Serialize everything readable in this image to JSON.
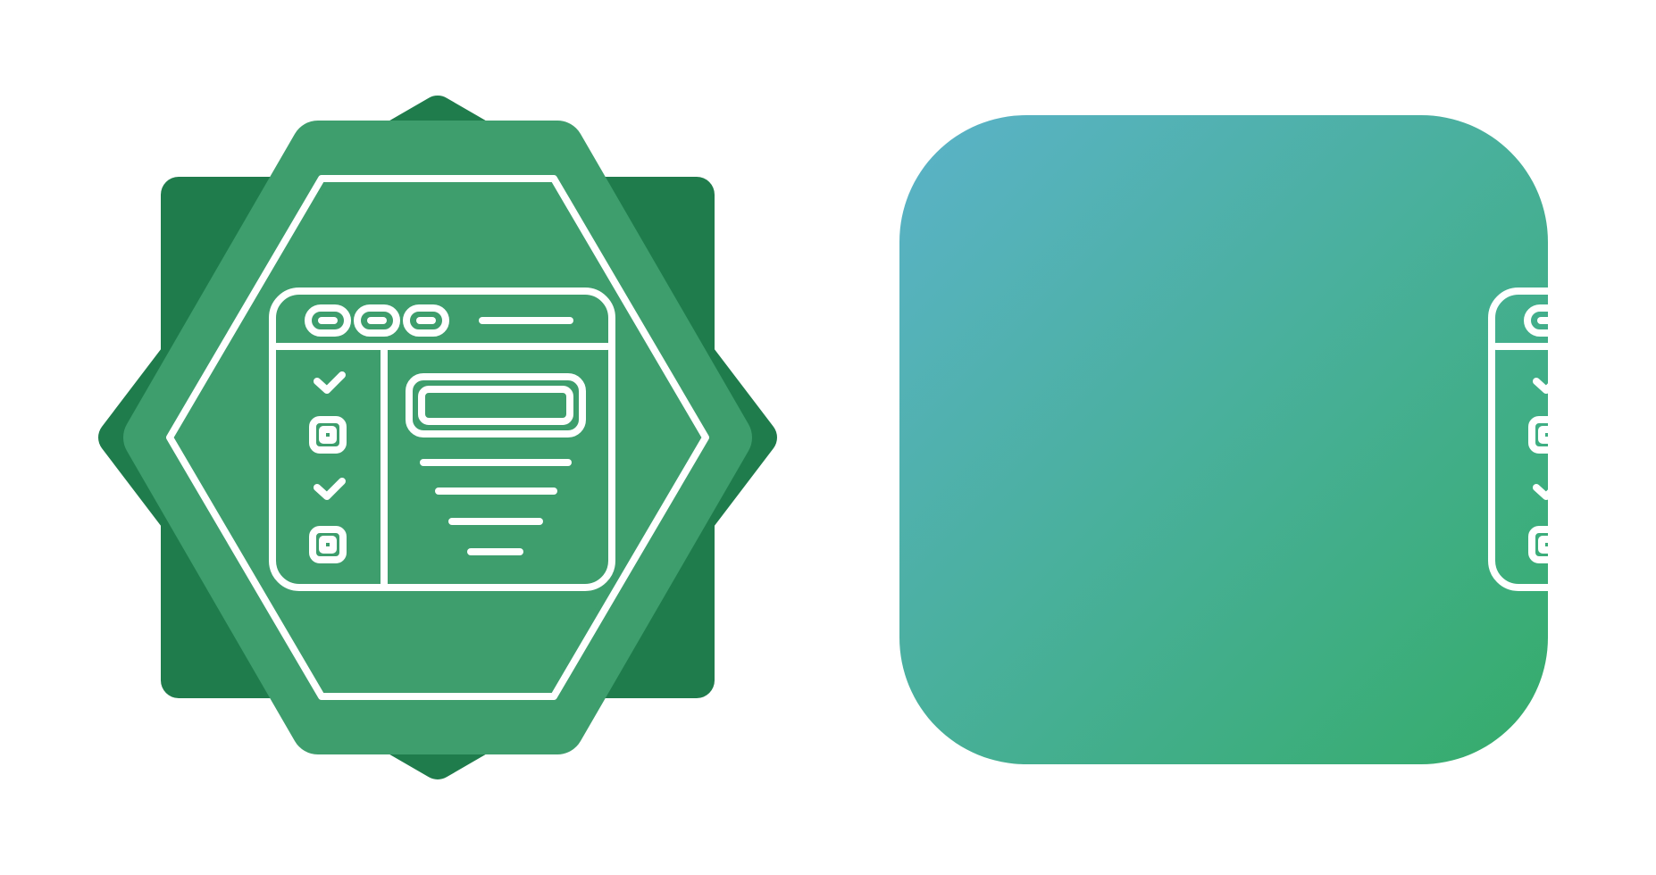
{
  "icons": [
    {
      "name": "checklist-window-badge-icon",
      "style": "badge",
      "colors": {
        "badge_dark": "#1f7c4c",
        "badge_main": "#3e9e6d",
        "line": "#ffffff"
      }
    },
    {
      "name": "checklist-window-gradient-icon",
      "style": "rounded-square-gradient",
      "colors": {
        "gradient_start": "#5bb3c9",
        "gradient_end": "#35ac6a",
        "line": "#ffffff"
      }
    }
  ],
  "glyph": {
    "elements": [
      "window-frame",
      "toolbar-pills",
      "address-bar",
      "checklist-sidebar",
      "content-box",
      "text-lines"
    ],
    "checklist": [
      "checked",
      "unchecked",
      "checked",
      "unchecked"
    ]
  }
}
